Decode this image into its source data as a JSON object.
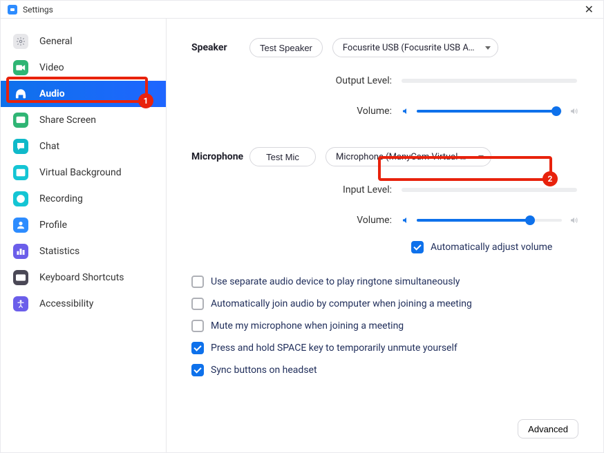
{
  "window": {
    "title": "Settings"
  },
  "sidebar": {
    "items": [
      {
        "key": "general",
        "label": "General"
      },
      {
        "key": "video",
        "label": "Video"
      },
      {
        "key": "audio",
        "label": "Audio",
        "active": true
      },
      {
        "key": "share",
        "label": "Share Screen"
      },
      {
        "key": "chat",
        "label": "Chat"
      },
      {
        "key": "vbg",
        "label": "Virtual Background"
      },
      {
        "key": "recording",
        "label": "Recording"
      },
      {
        "key": "profile",
        "label": "Profile"
      },
      {
        "key": "stats",
        "label": "Statistics"
      },
      {
        "key": "shortcuts",
        "label": "Keyboard Shortcuts"
      },
      {
        "key": "a11y",
        "label": "Accessibility"
      }
    ]
  },
  "speaker": {
    "section_label": "Speaker",
    "test_label": "Test Speaker",
    "device": "Focusrite USB (Focusrite USB Aud…",
    "output_level_label": "Output Level:",
    "volume_label": "Volume:",
    "volume_percent": 96
  },
  "mic": {
    "section_label": "Microphone",
    "test_label": "Test Mic",
    "device": "Microphone (ManyCam Virtual M…",
    "input_level_label": "Input Level:",
    "volume_label": "Volume:",
    "volume_percent": 78,
    "auto_adjust_label": "Automatically adjust volume",
    "auto_adjust_checked": true
  },
  "options": [
    {
      "label": "Use separate audio device to play ringtone simultaneously",
      "checked": false
    },
    {
      "label": "Automatically join audio by computer when joining a meeting",
      "checked": false
    },
    {
      "label": "Mute my microphone when joining a meeting",
      "checked": false
    },
    {
      "label": "Press and hold SPACE key to temporarily unmute yourself",
      "checked": true
    },
    {
      "label": "Sync buttons on headset",
      "checked": true
    }
  ],
  "advanced_label": "Advanced",
  "annotations": {
    "callout1": "1",
    "callout2": "2"
  },
  "colors": {
    "zoom_blue": "#0e71eb",
    "callout_red": "#e8220c"
  }
}
